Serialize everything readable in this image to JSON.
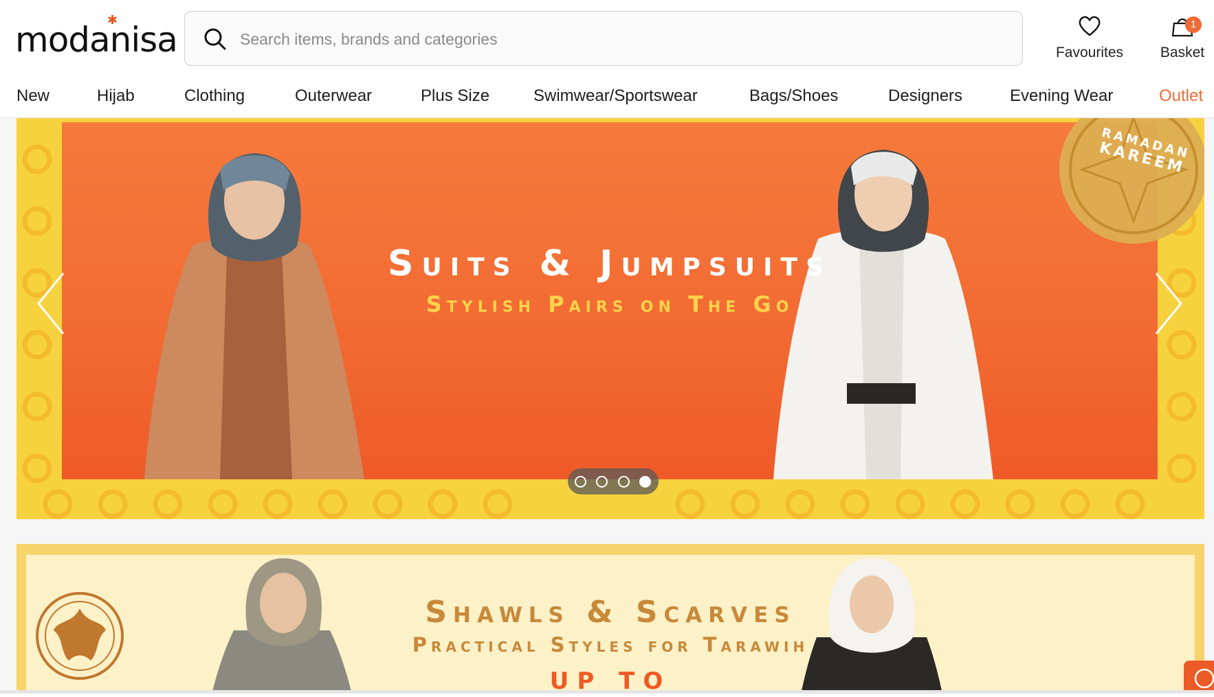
{
  "header": {
    "logo_text": "modanisa",
    "search_placeholder": "Search items, brands and categories",
    "favourites_label": "Favourites",
    "basket_label": "Basket",
    "basket_count": "1"
  },
  "nav": {
    "items": [
      {
        "label": "New"
      },
      {
        "label": "Hijab"
      },
      {
        "label": "Clothing"
      },
      {
        "label": "Outerwear"
      },
      {
        "label": "Plus Size"
      },
      {
        "label": "Swimwear/Sportswear"
      },
      {
        "label": "Bags/Shoes"
      },
      {
        "label": "Designers"
      },
      {
        "label": "Evening Wear"
      },
      {
        "label": "Outlet"
      }
    ]
  },
  "banner1": {
    "title": "Suits & Jumpsuits",
    "subtitle": "Stylish Pairs on The Go",
    "seal_line1": "RAMADAN",
    "seal_line2": "KAREEM",
    "active_slide": 4,
    "slide_count": 4
  },
  "banner2": {
    "title": "Shawls & Scarves",
    "subtitle": "Practical Styles for Tarawih",
    "promo": "UP TO"
  },
  "colors": {
    "brand": "#f06a35",
    "banner_orange": "#f26a32",
    "banner_yellow": "#f7d23f",
    "gold_text": "#ffd34a",
    "banner2_bg": "#fdf1c8",
    "banner2_text": "#c8893a"
  },
  "icons": {
    "search": "search-icon",
    "favourites": "heart-icon",
    "basket": "shopping-bag-icon",
    "prev": "chevron-left-icon",
    "next": "chevron-right-icon",
    "chat": "chat-icon"
  }
}
